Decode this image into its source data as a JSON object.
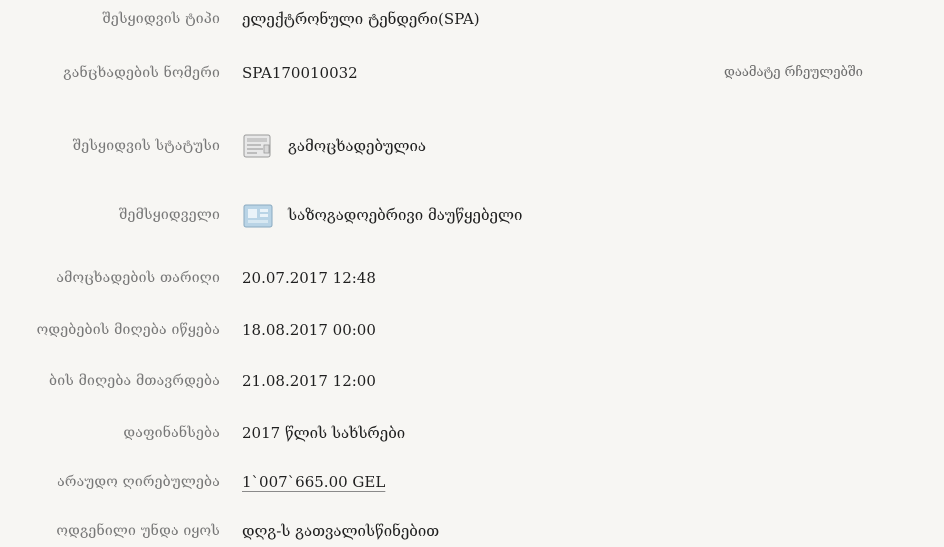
{
  "tender": {
    "type_label": "შესყიდვის ტიპი",
    "type_value": "ელექტრონული ტენდერი(SPA)",
    "number_label": "განცხადების ნომერი",
    "number_value": "SPA170010032",
    "add_rules": "დაამატე რჩეულებში",
    "status_label": "შესყიდვის სტატუსი",
    "status_value": "გამოცხადებულია",
    "status_icon": "document-icon",
    "buyer_label": "შემსყიდველი",
    "buyer_value": "საზოგადოებრივი მაუწყებელი",
    "buyer_icon": "organization-icon",
    "announce_date_label": "ამოცხადების თარიღი",
    "announce_date_value": "20.07.2017 12:48",
    "offers_start_label": "ოდებების მიღება იწყება",
    "offers_start_value": "18.08.2017 00:00",
    "offers_end_label": "ბის მიღება მთავრდება",
    "offers_end_value": "21.08.2017 12:00",
    "funding_label": "დაფინანსება",
    "funding_value": "2017 წლის სახსრები",
    "estimated_value_label": "არაუდო ღირებულება",
    "estimated_value_value": "1`007`665.00 GEL",
    "must_be_label": "ოდგენილი უნდა იყოს",
    "must_be_value": "დღგ-ს გათვალისწინებით"
  }
}
